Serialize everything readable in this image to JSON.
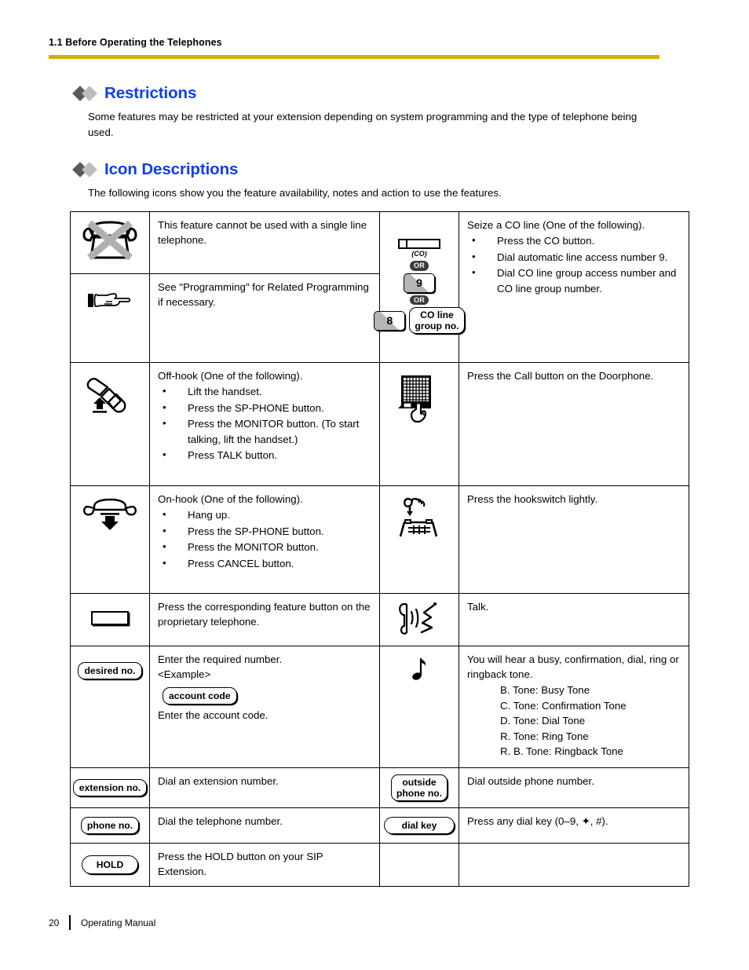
{
  "header": {
    "breadcrumb": "1.1 Before Operating the Telephones",
    "rule_color": "#dbab0b"
  },
  "sections": [
    {
      "title": "Restrictions",
      "body": "Some features may be restricted at your extension depending on system programming and the type of telephone being used."
    },
    {
      "title": "Icon Descriptions",
      "body": "The following icons show you the feature availability, notes and action to use the features."
    }
  ],
  "table": {
    "rows": [
      {
        "left": {
          "icon": "crossed-telephone-icon",
          "lead": "This feature cannot be used with a single line telephone."
        },
        "right": {
          "icon": "co-line-keys-icon",
          "co_button_label": "(CO)",
          "or_label_1": "OR",
          "key_9": "9",
          "or_label_2": "OR",
          "key_8": "8",
          "co_group_chip": "CO line\ngroup no.",
          "co_group_line1": "CO line",
          "co_group_line2": "group no.",
          "lead": "Seize a CO line (One of the following).",
          "bullets": [
            "Press the CO button.",
            "Dial automatic line access number 9.",
            "Dial CO line group access number and CO line group number."
          ]
        }
      },
      {
        "left": {
          "icon": "pointing-hand-icon",
          "lead": "See \"Programming\" for Related Programming if necessary."
        }
      },
      {
        "left": {
          "icon": "offhook-handset-icon",
          "lead": "Off-hook (One of the following).",
          "bullets": [
            "Lift the handset.",
            "Press the SP-PHONE button.",
            "Press the MONITOR button. (To start talking, lift the handset.)",
            "Press TALK button."
          ]
        },
        "right": {
          "icon": "doorphone-icon",
          "lead": "Press the Call button on the Doorphone."
        }
      },
      {
        "left": {
          "icon": "onhook-handset-icon",
          "lead": "On-hook (One of the following).",
          "bullets": [
            "Hang up.",
            "Press the SP-PHONE button.",
            "Press the MONITOR button.",
            "Press CANCEL button."
          ]
        },
        "right": {
          "icon": "hookswitch-icon",
          "lead": "Press the hookswitch lightly."
        }
      },
      {
        "left": {
          "icon": "feature-button-icon",
          "lead": "Press the corresponding feature button on the proprietary telephone."
        },
        "right": {
          "icon": "talk-icon",
          "lead": "Talk."
        }
      },
      {
        "left": {
          "icon": "desired-no-chip",
          "chip": "desired no.",
          "lead": "Enter the required number.",
          "example_label": "<Example>",
          "example_chip": "account code",
          "example_text": "Enter the account code."
        },
        "right": {
          "icon": "tone-note-icon",
          "lead": "You will hear a busy, confirmation, dial, ring or ringback tone.",
          "tones": [
            "B. Tone: Busy Tone",
            "C. Tone: Confirmation Tone",
            "D. Tone: Dial Tone",
            "R. Tone: Ring Tone",
            "R. B. Tone: Ringback Tone"
          ]
        }
      },
      {
        "left": {
          "icon": "extension-no-chip",
          "chip": "extension no.",
          "lead": "Dial an extension number."
        },
        "right": {
          "icon": "outside-phone-no-chip",
          "chip_line1": "outside",
          "chip_line2": "phone no.",
          "lead": "Dial outside phone number."
        }
      },
      {
        "left": {
          "icon": "phone-no-chip",
          "chip": "phone no.",
          "lead": "Dial the telephone number."
        },
        "right": {
          "icon": "dial-key-chip",
          "chip": "dial key",
          "lead": "Press any dial key (0–9, ✦, #)."
        }
      },
      {
        "left": {
          "icon": "hold-chip",
          "chip": "HOLD",
          "lead": "Press the HOLD button on your SIP Extension."
        },
        "right": {
          "icon": "",
          "lead": ""
        }
      }
    ]
  },
  "footer": {
    "page_number": "20",
    "manual_name": "Operating Manual"
  }
}
